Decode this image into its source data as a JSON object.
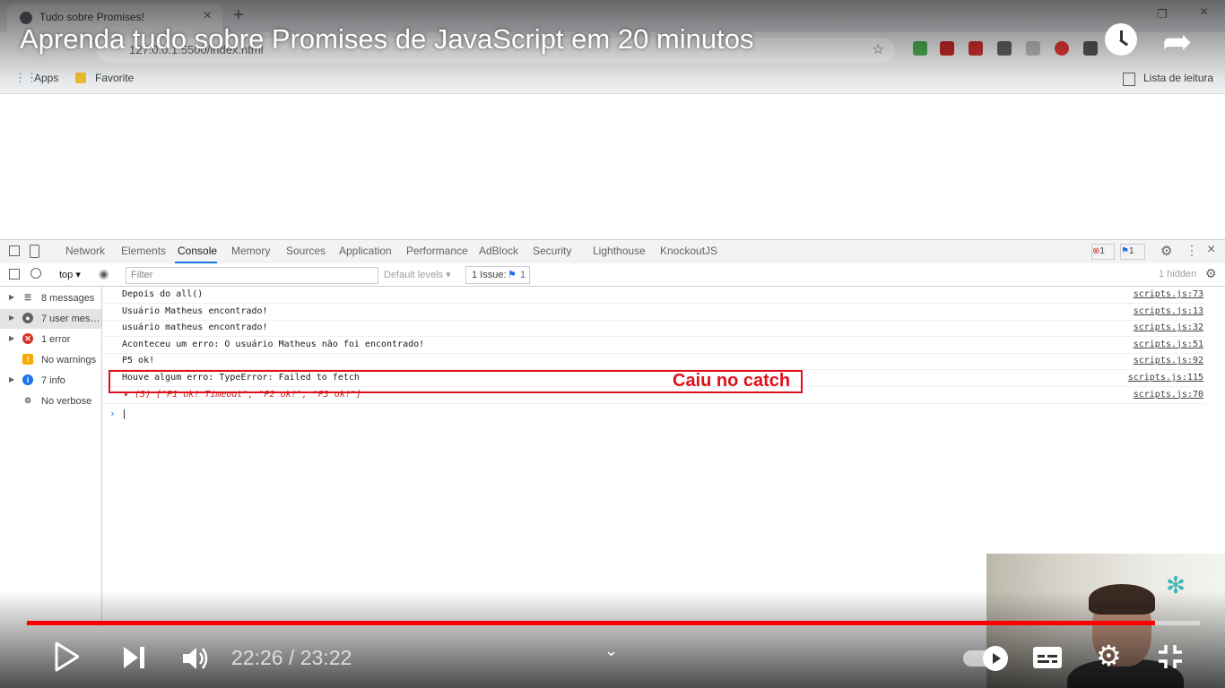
{
  "browser": {
    "tab_title": "Tudo sobre Promises!",
    "url": "127.0.0.1:5500/index.html",
    "bookmarks": {
      "apps": "Apps",
      "favorite": "Favorite",
      "reading_list": "Lista de leitura"
    }
  },
  "video": {
    "title": "Aprenda tudo sobre Promises de JavaScript em 20 minutos",
    "time": "22:26 / 23:22",
    "progress": 0.962
  },
  "devtools": {
    "tabs": [
      "Network",
      "Elements",
      "Console",
      "Memory",
      "Sources",
      "Application",
      "Performance",
      "AdBlock",
      "Security",
      "Lighthouse",
      "KnockoutJS"
    ],
    "active_tab": "Console",
    "error_count": "1",
    "issue_count": "1",
    "context": "top ▾",
    "filter_placeholder": "Filter",
    "levels": "Default levels ▾",
    "issues": "1 Issue:",
    "issues_count": "1",
    "hidden": "1 hidden",
    "sidebar": [
      {
        "label": "8 messages",
        "icon": "list-icon"
      },
      {
        "label": "7 user mess...",
        "icon": "user-icon"
      },
      {
        "label": "1 error",
        "icon": "error-icon"
      },
      {
        "label": "No warnings",
        "icon": "warning-icon"
      },
      {
        "label": "7 info",
        "icon": "info-icon"
      },
      {
        "label": "No verbose",
        "icon": "verbose-icon"
      }
    ],
    "logs": [
      {
        "text": "Depois do all()",
        "source": "scripts.js:73"
      },
      {
        "text": "Usuário Matheus encontrado!",
        "source": "scripts.js:13"
      },
      {
        "text": "usuário matheus encontrado!",
        "source": "scripts.js:32"
      },
      {
        "text": "Aconteceu um erro: O usuário Matheus não foi encontrado!",
        "source": "scripts.js:51"
      },
      {
        "text": "P5 ok!",
        "source": "scripts.js:92"
      },
      {
        "text": "Houve algum erro: TypeError: Failed to fetch",
        "source": "scripts.js:115"
      },
      {
        "text": "▸ (3) [\"P1 ok! Timeout\", \"P2 ok!\", \"P3 ok!\"]",
        "source": "scripts.js:70"
      }
    ],
    "annotation": "Caiu no catch",
    "prompt": "›"
  }
}
